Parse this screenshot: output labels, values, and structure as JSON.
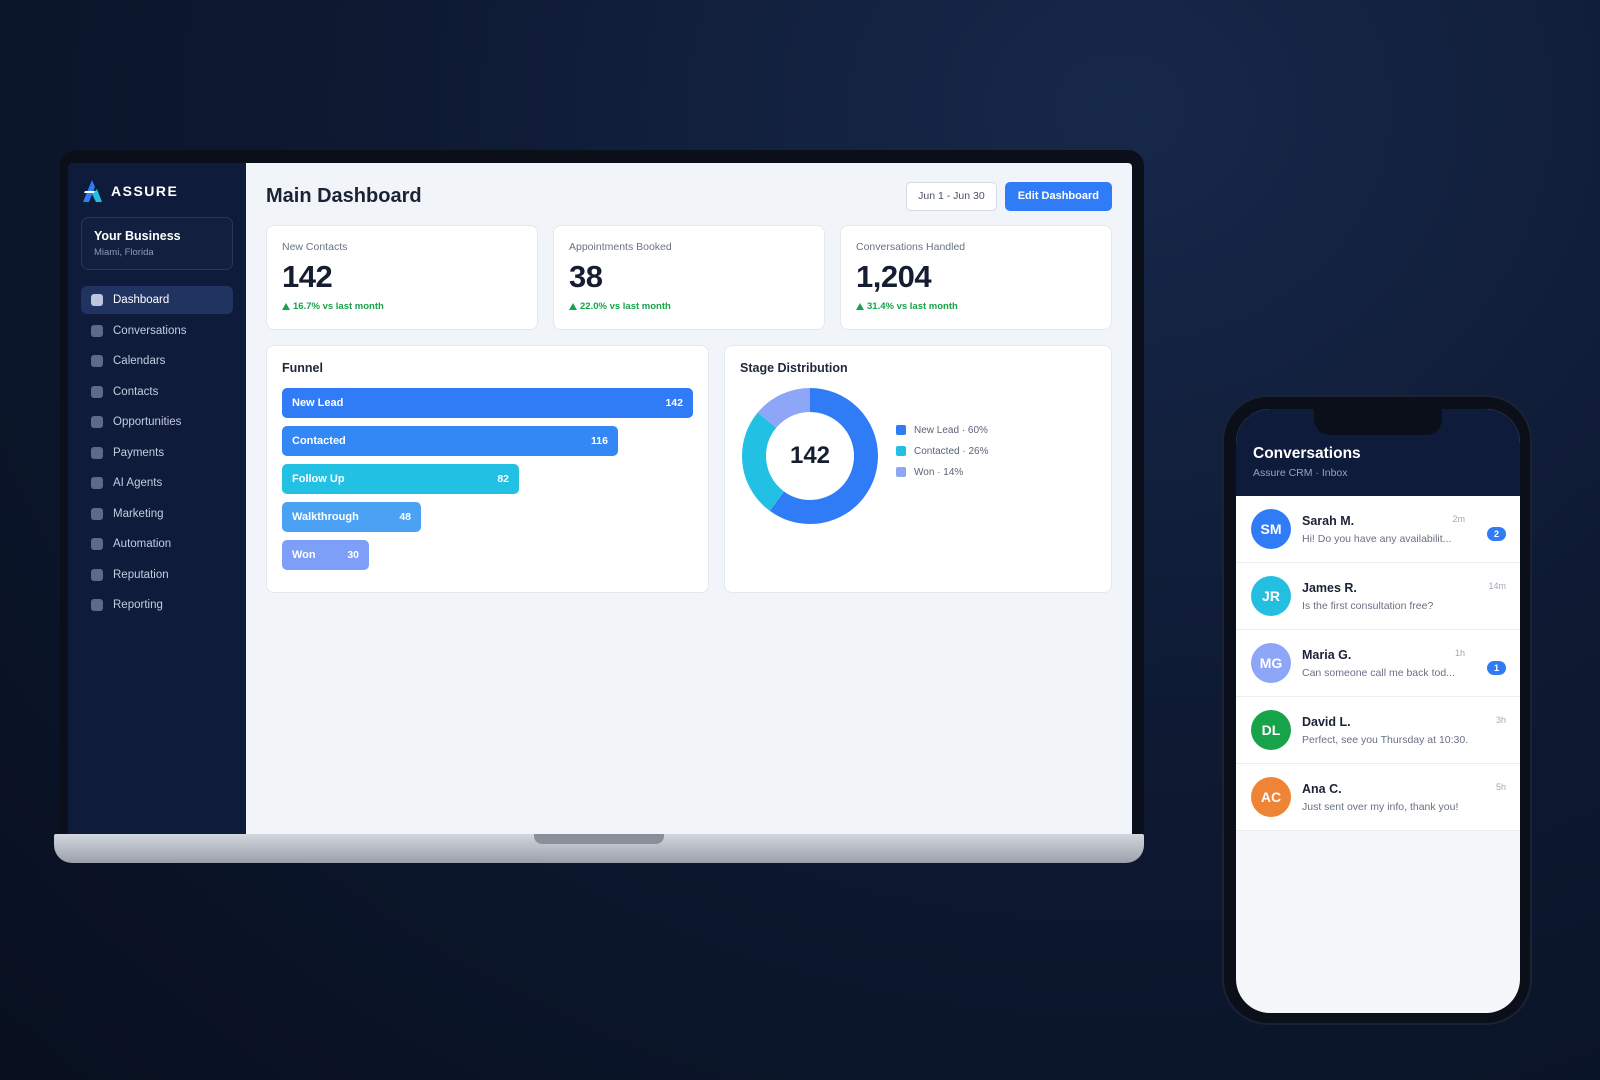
{
  "app": {
    "brand": "ASSURE",
    "business": {
      "name": "Your Business",
      "location": "Miami, Florida"
    }
  },
  "sidebar": {
    "items": [
      {
        "label": "Dashboard",
        "active": true
      },
      {
        "label": "Conversations"
      },
      {
        "label": "Calendars"
      },
      {
        "label": "Contacts"
      },
      {
        "label": "Opportunities"
      },
      {
        "label": "Payments"
      },
      {
        "label": "AI Agents"
      },
      {
        "label": "Marketing"
      },
      {
        "label": "Automation"
      },
      {
        "label": "Reputation"
      },
      {
        "label": "Reporting"
      }
    ]
  },
  "header": {
    "title": "Main Dashboard",
    "date_range": "Jun 1 - Jun 30",
    "edit_label": "Edit Dashboard"
  },
  "stats": [
    {
      "label": "New Contacts",
      "value": "142",
      "delta": "16.7% vs last month"
    },
    {
      "label": "Appointments Booked",
      "value": "38",
      "delta": "22.0% vs last month"
    },
    {
      "label": "Conversations Handled",
      "value": "1,204",
      "delta": "31.4% vs last month"
    }
  ],
  "funnel": {
    "title": "Funnel",
    "max": 142,
    "stages": [
      {
        "label": "New Lead",
        "value": "142",
        "color": "#2f7cf6"
      },
      {
        "label": "Contacted",
        "value": "116",
        "color": "#3488f5"
      },
      {
        "label": "Follow Up",
        "value": "82",
        "color": "#22c0e3"
      },
      {
        "label": "Walkthrough",
        "value": "48",
        "color": "#4ba2f4"
      },
      {
        "label": "Won",
        "value": "30",
        "color": "#7d9ff7"
      }
    ]
  },
  "stage_distribution": {
    "title": "Stage Distribution",
    "center_value": "142",
    "slices": [
      {
        "label": "New Lead · 60%",
        "percent": 60,
        "color": "#2f7cf6"
      },
      {
        "label": "Contacted · 26%",
        "percent": 26,
        "color": "#22c0e3"
      },
      {
        "label": "Won · 14%",
        "percent": 14,
        "color": "#8ea6f7"
      }
    ]
  },
  "phone": {
    "title": "Conversations",
    "subtitle": "Assure CRM · Inbox",
    "conversations": [
      {
        "initials": "SM",
        "name": "Sarah M.",
        "message": "Hi! Do you have any availabilit...",
        "time": "2m",
        "badge": "2",
        "color": "#2f7cf6"
      },
      {
        "initials": "JR",
        "name": "James R.",
        "message": "Is the first consultation free?",
        "time": "14m",
        "badge": "",
        "color": "#24bfe0"
      },
      {
        "initials": "MG",
        "name": "Maria G.",
        "message": "Can someone call me back tod...",
        "time": "1h",
        "badge": "1",
        "color": "#8ea6f7"
      },
      {
        "initials": "DL",
        "name": "David L.",
        "message": "Perfect, see you Thursday at 10:30.",
        "time": "3h",
        "badge": "",
        "color": "#17a34a"
      },
      {
        "initials": "AC",
        "name": "Ana C.",
        "message": "Just sent over my info, thank you!",
        "time": "5h",
        "badge": "",
        "color": "#ef8436"
      }
    ]
  }
}
